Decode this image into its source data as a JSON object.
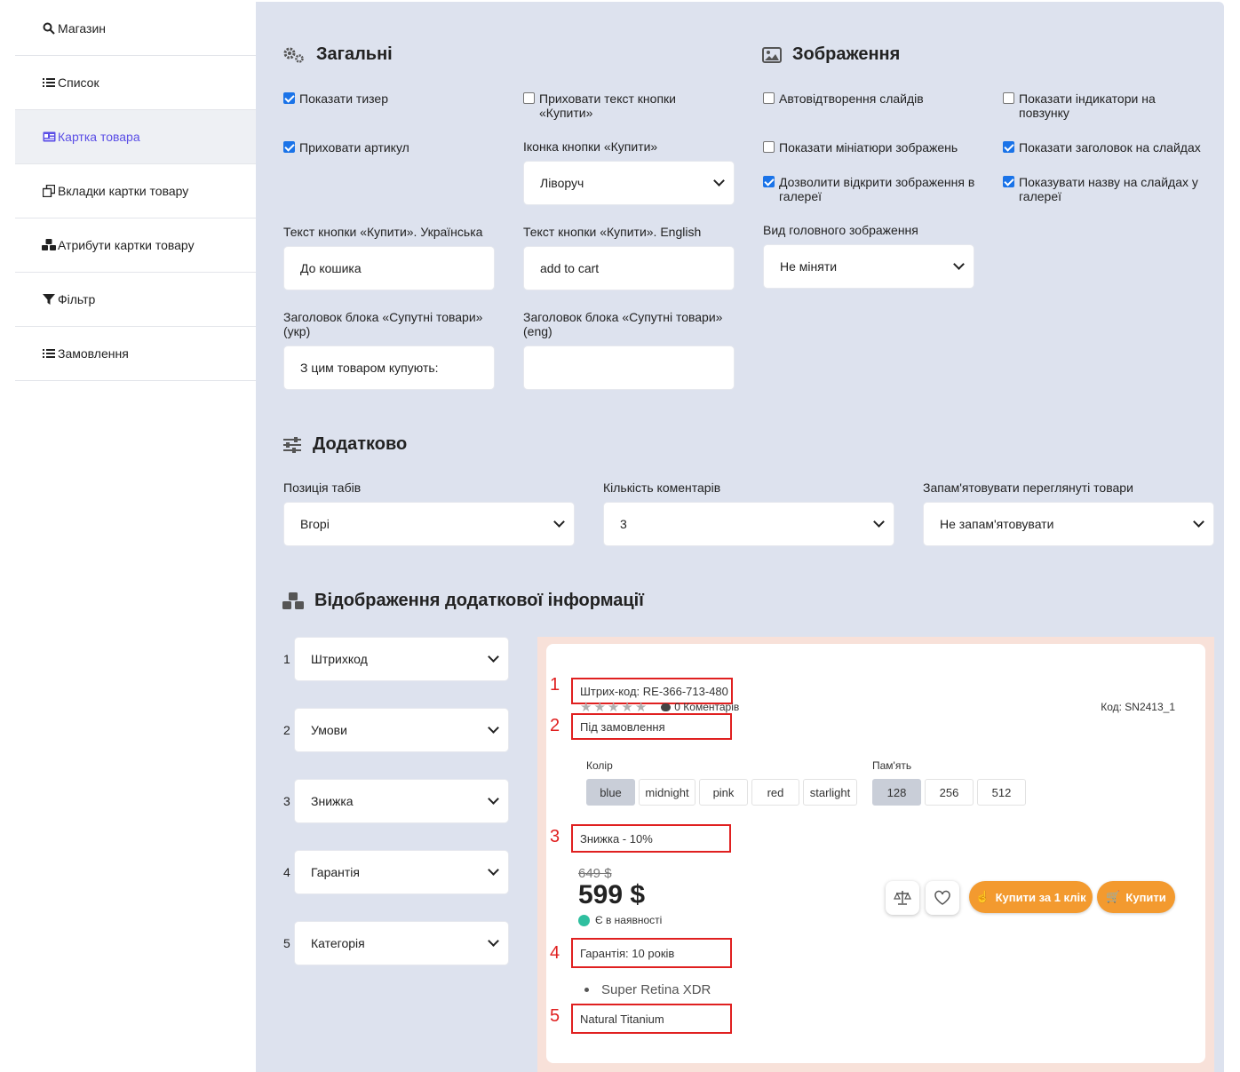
{
  "sidebar": {
    "items": [
      {
        "label": "Магазин",
        "icon": "search-icon"
      },
      {
        "label": "Список",
        "icon": "list-icon"
      },
      {
        "label": "Картка товара",
        "icon": "id-card-icon",
        "active": true
      },
      {
        "label": "Вкладки картки товару",
        "icon": "copy-icon"
      },
      {
        "label": "Атрибути картки товару",
        "icon": "cubes-icon"
      },
      {
        "label": "Фільтр",
        "icon": "filter-icon"
      },
      {
        "label": "Замовлення",
        "icon": "list-icon"
      }
    ]
  },
  "general": {
    "title": "Загальні",
    "show_teaser": "Показати тизер",
    "hide_buy_text": "Приховати текст кнопки «Купити»",
    "hide_sku": "Приховати артикул",
    "buy_icon_label": "Іконка кнопки «Купити»",
    "buy_icon_value": "Ліворуч",
    "buy_text_ua_label": "Текст кнопки «Купити». Українська",
    "buy_text_ua_value": "До кошика",
    "buy_text_en_label": "Текст кнопки «Купити». English",
    "buy_text_en_value": "add to cart",
    "related_ua_label": "Заголовок блока «Супутні товари» (укр)",
    "related_ua_value": "З цим товаром купують:",
    "related_en_label": "Заголовок блока «Супутні товари» (eng)",
    "related_en_value": ""
  },
  "images": {
    "title": "Зображення",
    "autoplay": "Автовідтворення слайдів",
    "slider_indicators": "Показати індикатори на повзунку",
    "thumbnails": "Показати мініатюри зображень",
    "slide_titles": "Показати заголовок на слайдах",
    "open_gallery": "Дозволити відкрити зображення в галереї",
    "gallery_names": "Показувати назву на слайдах у галереї",
    "main_view_label": "Вид головного зображення",
    "main_view_value": "Не міняти"
  },
  "extra": {
    "title": "Додатково",
    "tabs_label": "Позиція табів",
    "tabs_value": "Вгорі",
    "comments_label": "Кількість коментарів",
    "comments_value": "3",
    "remember_label": "Запам'ятовувати переглянуті товари",
    "remember_value": "Не запам'ятовувати"
  },
  "info": {
    "title": "Відображення додаткової інформації",
    "rows": [
      {
        "num": "1",
        "value": "Штрихкод"
      },
      {
        "num": "2",
        "value": "Умови"
      },
      {
        "num": "3",
        "value": "Знижка"
      },
      {
        "num": "4",
        "value": "Гарантія"
      },
      {
        "num": "5",
        "value": "Категорія"
      }
    ]
  },
  "preview": {
    "barcode": "Штрих-код: RE-366-713-480",
    "comments": "0 Коментарів",
    "code": "Код: SN2413_1",
    "condition": "Під замовлення",
    "color_label": "Колір",
    "colors": [
      "blue",
      "midnight",
      "pink",
      "red",
      "starlight"
    ],
    "memory_label": "Пам'ять",
    "memory": [
      "128",
      "256",
      "512"
    ],
    "discount": "Знижка - 10%",
    "old_price": "649 $",
    "price": "599 $",
    "stock": "Є в наявності",
    "warranty": "Гарантія: 10 років",
    "feature": "Super Retina XDR",
    "category": "Natural Titanium",
    "buy_one_click": "Купити за 1 клік",
    "buy": "Купити",
    "markers": [
      "1",
      "2",
      "3",
      "4",
      "5"
    ],
    "accent": "#f39a2f",
    "highlight": "#e02020"
  }
}
